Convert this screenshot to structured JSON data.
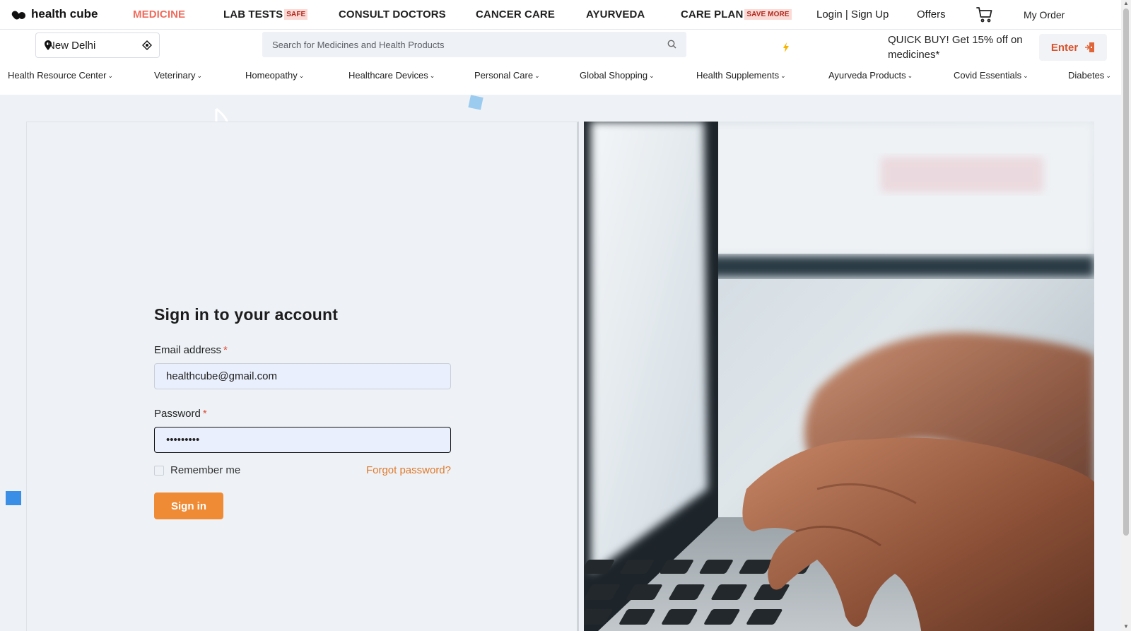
{
  "brand": {
    "name": "health cube"
  },
  "topnav": {
    "items": [
      {
        "label": "MEDICINE",
        "badge": ""
      },
      {
        "label": "LAB TESTS",
        "badge": "SAFE"
      },
      {
        "label": "CONSULT DOCTORS",
        "badge": ""
      },
      {
        "label": "CANCER CARE",
        "badge": ""
      },
      {
        "label": "AYURVEDA",
        "badge": ""
      },
      {
        "label": "CARE PLAN",
        "badge": "SAVE MORE"
      }
    ],
    "login": "Login | Sign Up",
    "offers": "Offers",
    "cart_icon": "cart-icon",
    "my_order": "My Order"
  },
  "location": {
    "value": "New Delhi",
    "pin_icon": "location-pin-icon",
    "gps_icon": "gps-icon"
  },
  "search": {
    "placeholder": "Search for Medicines and Health Products",
    "icon": "search-icon"
  },
  "promo": {
    "bolt_icon": "lightning-icon",
    "text": "QUICK BUY! Get 15% off on medicines*",
    "button_label": "Enter",
    "button_icon": "door-enter-icon"
  },
  "categories": [
    "Health Resource Center",
    "Veterinary",
    "Homeopathy",
    "Healthcare Devices",
    "Personal Care",
    "Global Shopping",
    "Health Supplements",
    "Ayurveda Products",
    "Covid Essentials",
    "Diabetes"
  ],
  "signin_form": {
    "title": "Sign in to your account",
    "email_label": "Email address",
    "email_value": "healthcube@gmail.com",
    "password_label": "Password",
    "password_value": "•••••••••",
    "required_mark": "*",
    "remember_label": "Remember me",
    "forgot_label": "Forgot password?",
    "submit_label": "Sign in"
  },
  "colors": {
    "accent_orange": "#f08b35",
    "nav_active": "#f06a5b",
    "link_orange": "#e07a2c",
    "required_red": "#e04e39",
    "page_bg": "#eef2f6"
  },
  "image": {
    "description_icon": "laptop-typing-photo"
  }
}
